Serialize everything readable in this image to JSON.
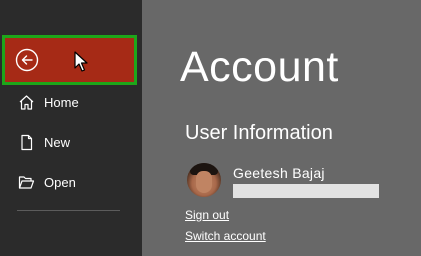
{
  "sidebar": {
    "items": [
      {
        "label": "Home",
        "icon": "home-icon"
      },
      {
        "label": "New",
        "icon": "new-document-icon"
      },
      {
        "label": "Open",
        "icon": "open-folder-icon"
      }
    ],
    "back_icon": "back-arrow-icon"
  },
  "main": {
    "title": "Account",
    "section_title": "User Information",
    "user": {
      "name": "Geetesh Bajaj"
    },
    "links": {
      "sign_out": "Sign out",
      "switch_account": "Switch account"
    }
  },
  "colors": {
    "sidebar_bg": "#2b2b2b",
    "main_bg": "#686868",
    "back_button_bg": "#a62a16",
    "highlight_border": "#1ea61a",
    "redaction": "#e2e2e2"
  }
}
